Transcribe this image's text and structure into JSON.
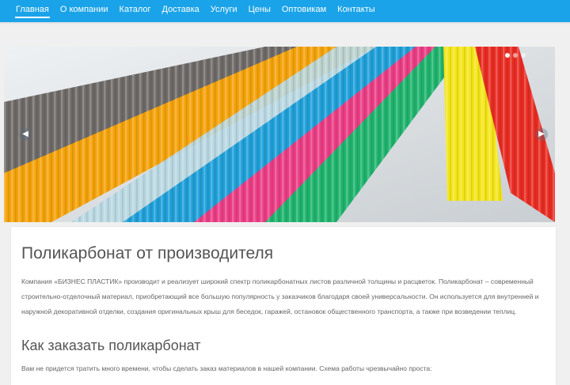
{
  "nav": {
    "items": [
      {
        "label": "Главная",
        "active": true
      },
      {
        "label": "О компании"
      },
      {
        "label": "Каталог"
      },
      {
        "label": "Доставка"
      },
      {
        "label": "Услуги"
      },
      {
        "label": "Цены"
      },
      {
        "label": "Оптовикам"
      },
      {
        "label": "Контакты"
      }
    ]
  },
  "slider": {
    "prev_icon": "chevron-left-icon",
    "next_icon": "chevron-right-icon",
    "dots": 3,
    "sheet_colors": [
      "#6e6a68",
      "#f4a20a",
      "#b6d7e2",
      "#1f9fd8",
      "#ea3d84",
      "#1fb36d",
      "#f3e51a",
      "#e82c22"
    ]
  },
  "main": {
    "title": "Поликарбонат от производителя",
    "intro": "Компания «БИЗНЕС ПЛАСТИК» производит и реализует широкий спектр поликарбонатных листов различной толщины и расцветок. Поликарбонат – современный строительно-отделочный материал, приобретающий все большую популярность у заказчиков благодаря своей универсальности. Он используется для внутренней и наружной декоративной отделки, создания оригинальных крыш для беседок, гаражей, остановок общественного транспорта, а также при возведении теплиц.",
    "subtitle": "Как заказать поликарбонат",
    "order_text": "Вам не придется тратить много времени, чтобы сделать заказ материалов в нашей компании. Схема работы чрезвычайно проста:"
  },
  "colors": {
    "nav_bg": "#1aa3e8",
    "page_bg": "#f0f0f0"
  }
}
